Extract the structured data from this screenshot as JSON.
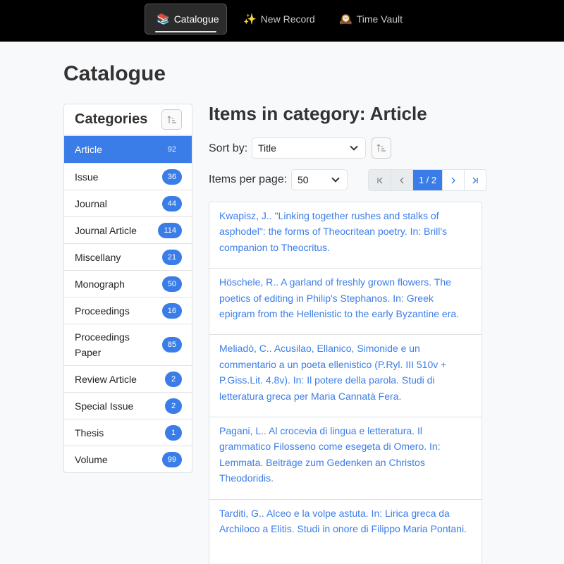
{
  "nav": {
    "items": [
      {
        "icon": "📚",
        "label": "Catalogue"
      },
      {
        "icon": "✨",
        "label": "New Record"
      },
      {
        "icon": "🕰️",
        "label": "Time Vault"
      }
    ]
  },
  "page_title": "Catalogue",
  "sidebar": {
    "title": "Categories",
    "sort_icon": "sort-ascending-icon",
    "items": [
      {
        "label": "Article",
        "count": "92"
      },
      {
        "label": "Issue",
        "count": "36"
      },
      {
        "label": "Journal",
        "count": "44"
      },
      {
        "label": "Journal Article",
        "count": "114"
      },
      {
        "label": "Miscellany",
        "count": "21"
      },
      {
        "label": "Monograph",
        "count": "50"
      },
      {
        "label": "Proceedings",
        "count": "16"
      },
      {
        "label": "Proceedings Paper",
        "count": "85"
      },
      {
        "label": "Review Article",
        "count": "2"
      },
      {
        "label": "Special Issue",
        "count": "2"
      },
      {
        "label": "Thesis",
        "count": "1"
      },
      {
        "label": "Volume",
        "count": "99"
      }
    ]
  },
  "main": {
    "title": "Items in category: Article",
    "sort_label": "Sort by:",
    "sort_value": "Title",
    "per_page_label": "Items per page:",
    "per_page_value": "50",
    "pagination": {
      "current": "1 / 2"
    },
    "records": [
      "Kwapisz, J.. \"Linking together rushes and stalks of asphodel\": the forms of Theocritean poetry. In: Brill's companion to Theocritus.",
      "Höschele, R.. A garland of freshly grown flowers. The poetics of editing in Philip's Stephanos. In: Greek epigram from the Hellenistic to the early Byzantine era.",
      "Meliadò, C.. Acusilao, Ellanico, Simonide e un commentario a un poeta ellenistico (P.Ryl. III 510v + P.Giss.Lit. 4.8v). In: Il potere della parola. Studi di letteratura greca per Maria Cannatà Fera.",
      "Pagani, L.. Al crocevia di lingua e letteratura. Il grammatico Filosseno come esegeta di Omero. In: Lemmata. Beiträge zum Gedenken an Christos Theodoridis.",
      "Tarditi, G.. Alceo e la volpe astuta. In: Lirica greca da Archiloco a Elitis. Studi in onore di Filippo Maria Pontani."
    ]
  },
  "colors": {
    "accent": "#3b7de8",
    "nav_bg": "#000000"
  }
}
